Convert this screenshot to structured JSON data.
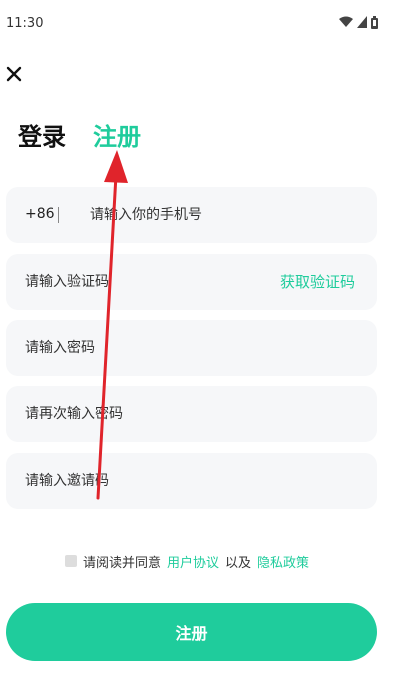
{
  "status_bar": {
    "time": "11:30"
  },
  "tabs": {
    "login": "登录",
    "register": "注册"
  },
  "form": {
    "country_code": "+86",
    "phone_placeholder": "请输入你的手机号",
    "code_placeholder": "请输入验证码",
    "get_code": "获取验证码",
    "password_placeholder": "请输入密码",
    "confirm_password_placeholder": "请再次输入密码",
    "invite_placeholder": "请输入邀请码"
  },
  "agreement": {
    "prefix": "请阅读并同意",
    "user_agreement": "用户协议",
    "conjunction": "以及",
    "privacy_policy": "隐私政策"
  },
  "submit_label": "注册",
  "colors": {
    "accent": "#1fcc9c",
    "field_bg": "#f6f7f9",
    "annotation": "#e0242b"
  },
  "icons": {
    "close": "close-icon",
    "wifi": "wifi-icon",
    "signal": "signal-icon",
    "battery": "battery-icon"
  }
}
